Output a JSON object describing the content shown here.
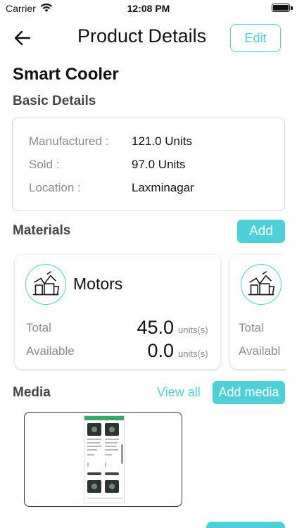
{
  "status_bar": {
    "carrier": "Carrier",
    "time": "12:08 PM"
  },
  "header": {
    "title": "Product Details",
    "edit_label": "Edit",
    "back_icon": "arrow-left-icon"
  },
  "product": {
    "name": "Smart Cooler"
  },
  "basic_details": {
    "title": "Basic Details",
    "rows": [
      {
        "key": "Manufactured :",
        "value": "121.0 Units"
      },
      {
        "key": "Sold :",
        "value": "97.0 Units"
      },
      {
        "key": "Location :",
        "value": "Laxminagar"
      }
    ]
  },
  "materials": {
    "title": "Materials",
    "add_label": "Add",
    "items": [
      {
        "name": "Motors",
        "icon": "tools-bucket-icon",
        "total_label": "Total",
        "total_value": "45.0",
        "total_unit": "units(s)",
        "available_label": "Available",
        "available_value": "0.0",
        "available_unit": "units(s)"
      },
      {
        "icon": "tools-bucket-icon",
        "total_label": "Total",
        "available_label": "Availabl"
      }
    ]
  },
  "media": {
    "title": "Media",
    "view_all_label": "View all",
    "add_media_label": "Add media"
  },
  "colors": {
    "accent": "#4fd0d8",
    "muted": "#8a8a8a",
    "text": "#111111"
  }
}
